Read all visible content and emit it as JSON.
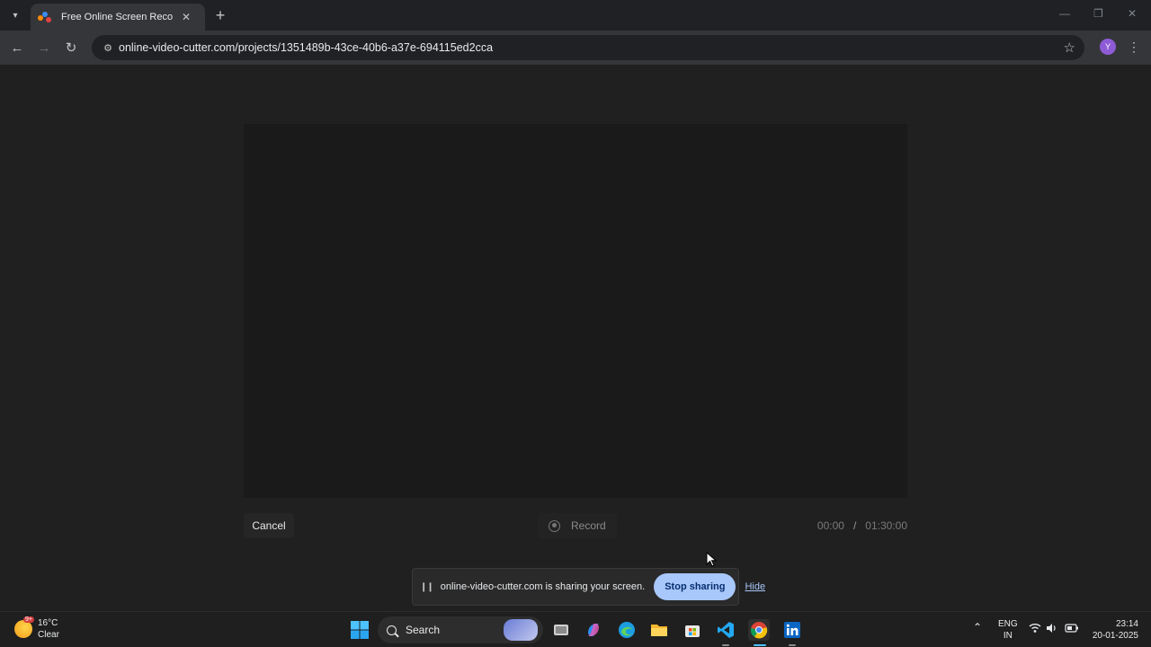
{
  "browser": {
    "tab_title": "Free Online Screen Recorder",
    "tab_close": "✕",
    "new_tab": "+",
    "url": "online-video-cutter.com/projects/1351489b-43ce-40b6-a37e-694115ed2cca",
    "profile_initial": "Y"
  },
  "recorder": {
    "cancel_label": "Cancel",
    "record_label": "Record",
    "elapsed": "00:00",
    "separator": "/",
    "limit": "01:30:00"
  },
  "share_bar": {
    "message": "online-video-cutter.com is sharing your screen.",
    "stop_label": "Stop sharing",
    "hide_label": "Hide"
  },
  "taskbar": {
    "weather_badge": "9+",
    "temperature": "16°C",
    "condition": "Clear",
    "search_label": "Search",
    "lang_primary": "ENG",
    "lang_secondary": "IN",
    "time": "23:14",
    "date": "20-01-2025",
    "icons": [
      "windows-start-icon",
      "search-icon",
      "task-view-icon",
      "copilot-icon",
      "edge-icon",
      "file-explorer-icon",
      "store-icon",
      "vscode-icon",
      "chrome-icon",
      "linkedin-icon"
    ]
  },
  "colors": {
    "accent": "#a8c7fa",
    "chrome_dark": "#202124",
    "toolbar": "#35363a"
  }
}
